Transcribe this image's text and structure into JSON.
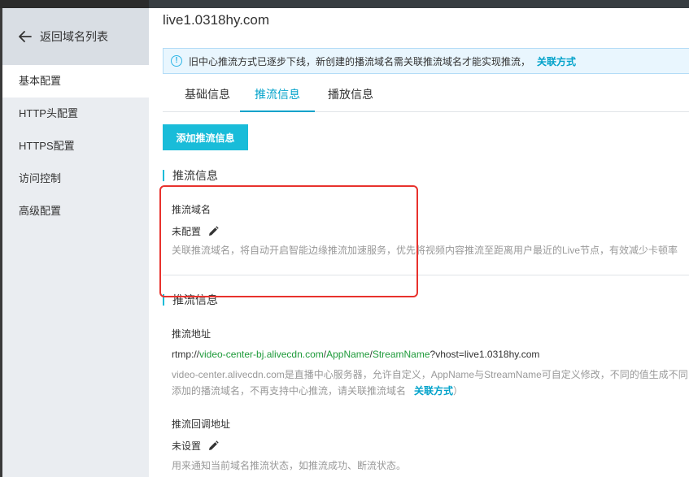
{
  "domain_title": "live1.0318hy.com",
  "sidebar": {
    "back_label": "返回域名列表",
    "items": [
      {
        "label": "基本配置",
        "active": true
      },
      {
        "label": "HTTP头配置",
        "active": false
      },
      {
        "label": "HTTPS配置",
        "active": false
      },
      {
        "label": "访问控制",
        "active": false
      },
      {
        "label": "高级配置",
        "active": false
      }
    ]
  },
  "notice": {
    "text": "旧中心推流方式已逐步下线，新创建的播流域名需关联推流域名才能实现推流，",
    "link": "关联方式"
  },
  "tabs": [
    {
      "label": "基础信息",
      "active": false
    },
    {
      "label": "推流信息",
      "active": true
    },
    {
      "label": "播放信息",
      "active": false
    }
  ],
  "add_button": "添加推流信息",
  "section1": {
    "title": "推流信息",
    "field_label": "推流域名",
    "value": "未配置",
    "desc": "关联推流域名，将自动开启智能边缘推流加速服务，优先将视频内容推流至距离用户最近的Live节点，有效减少卡顿率"
  },
  "section2": {
    "title": "推流信息",
    "address_label": "推流地址",
    "rtmp": {
      "prefix": "rtmp://",
      "host": "video-center-bj.alivecdn.com",
      "sep1": "/",
      "app": "AppName",
      "sep2": "/",
      "stream": "StreamName",
      "suffix": "?vhost=live1.0318hy.com"
    },
    "desc_line1": "video-center.alivecdn.com是直播中心服务器，允许自定义，AppName与StreamName可自定义修改，不同的值生成不同",
    "desc_line2": "添加的播流域名，不再支持中心推流，请关联推流域名",
    "desc_link": "关联方式",
    "desc_close": "）",
    "callback_label": "推流回调地址",
    "callback_value": "未设置",
    "callback_desc": "用来通知当前域名推流状态，如推流成功、断流状态。"
  },
  "colors": {
    "accent": "#19bcd9",
    "link": "#00a2ca",
    "highlight": "#e8322d",
    "green_text": "#1e9a3a"
  }
}
